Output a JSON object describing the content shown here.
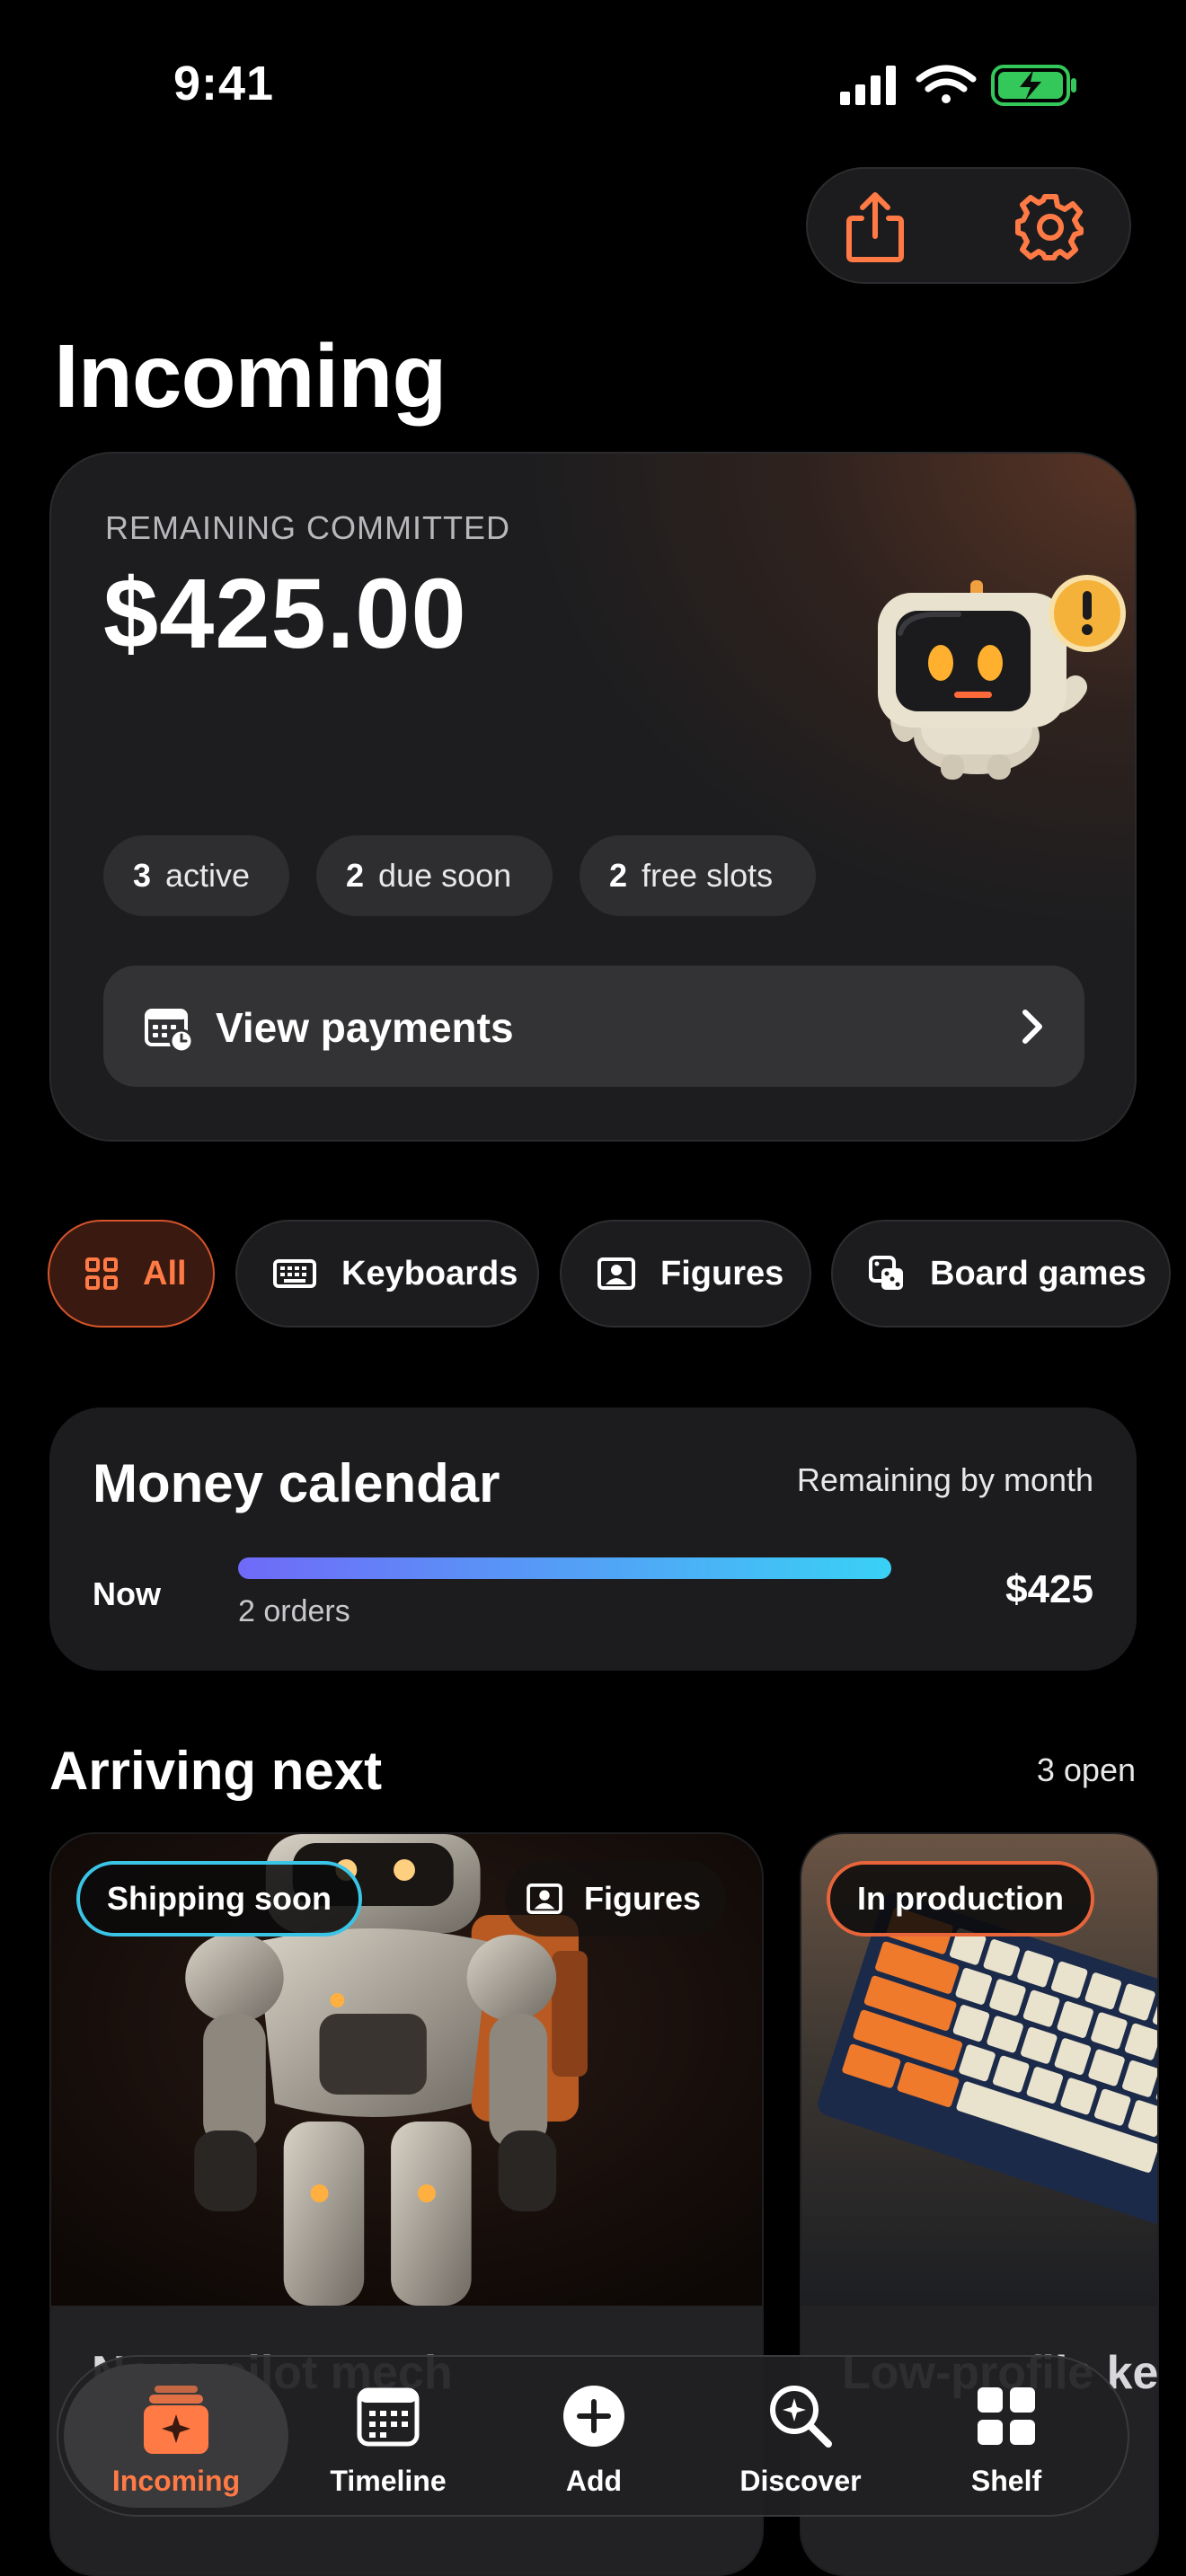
{
  "status_bar": {
    "time": "9:41"
  },
  "header": {
    "share_icon": "share-icon",
    "settings_icon": "gear-icon"
  },
  "page_title": "Incoming",
  "summary": {
    "label": "REMAINING COMMITTED",
    "amount": "$425.00",
    "chips": [
      {
        "count": "3",
        "label": "active"
      },
      {
        "count": "2",
        "label": "due soon"
      },
      {
        "count": "2",
        "label": "free slots"
      }
    ],
    "view_payments_label": "View payments"
  },
  "filters": [
    {
      "label": "All",
      "icon": "grid-icon",
      "active": true
    },
    {
      "label": "Keyboards",
      "icon": "keyboard-icon"
    },
    {
      "label": "Figures",
      "icon": "figure-icon"
    },
    {
      "label": "Board games",
      "icon": "dice-icon"
    }
  ],
  "money_calendar": {
    "title": "Money calendar",
    "subtitle": "Remaining by month",
    "rows": [
      {
        "label": "Now",
        "orders": "2 orders",
        "amount": "$425"
      }
    ]
  },
  "arriving": {
    "title": "Arriving next",
    "count": "3 open",
    "cards": [
      {
        "status": "Shipping soon",
        "category": "Figures",
        "name": "Nova pilot mech"
      },
      {
        "status": "In production",
        "name": "Low-profile keyboard"
      }
    ]
  },
  "tabs": [
    {
      "label": "Incoming",
      "icon": "incoming-icon",
      "active": true
    },
    {
      "label": "Timeline",
      "icon": "calendar-icon"
    },
    {
      "label": "Add",
      "icon": "plus-circle-icon"
    },
    {
      "label": "Discover",
      "icon": "discover-icon"
    },
    {
      "label": "Shelf",
      "icon": "shelf-icon"
    }
  ],
  "colors": {
    "accent": "#ff7a45",
    "shipping_badge": "#3ac4e6",
    "production_badge": "#e8643a"
  }
}
